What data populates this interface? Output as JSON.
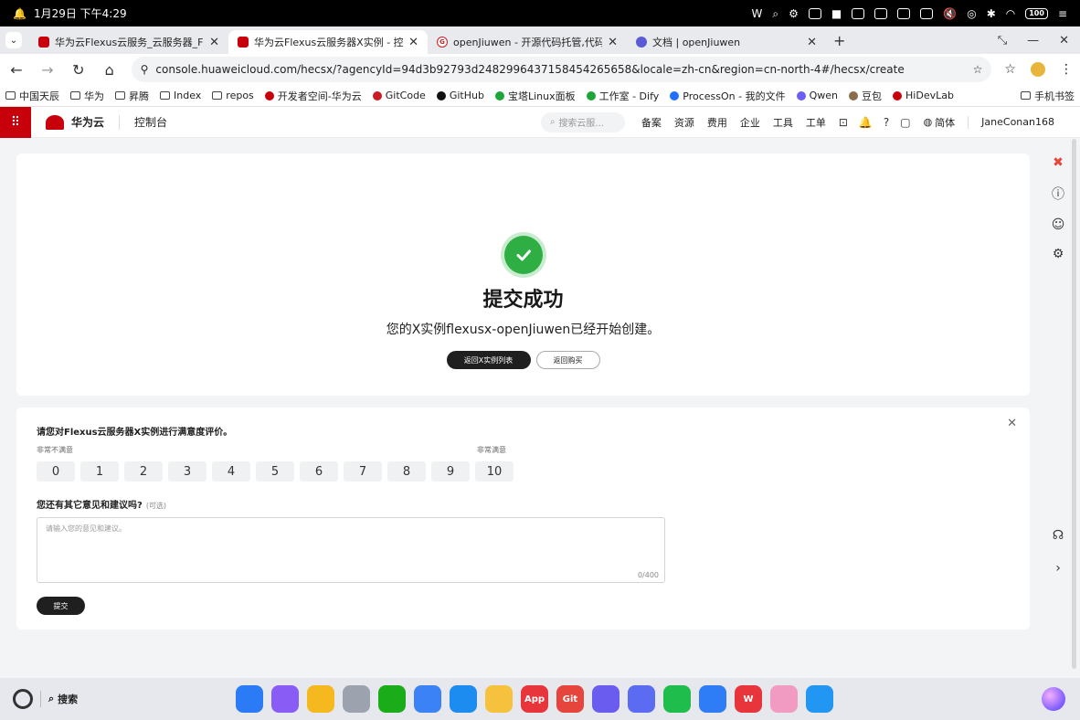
{
  "statusbar": {
    "datetime": "1月29日 下午4:29",
    "battery": "100"
  },
  "tabs": [
    {
      "label": "华为云Flexus云服务_云服务器_Flexu",
      "favicon": "huawei"
    },
    {
      "label": "华为云Flexus云服务器X实例 - 控制",
      "favicon": "huawei"
    },
    {
      "label": "openJiuwen - 开源代码托管,代码协",
      "favicon": "gitcode"
    },
    {
      "label": "文档 | openJiuwen",
      "favicon": "doc"
    }
  ],
  "address": {
    "url": "console.huaweicloud.com/hecsx/?agencyId=94d3b92793d2482996437158454265658&locale=zh-cn&region=cn-north-4#/hecsx/create"
  },
  "bookmarks": [
    "中国天辰",
    "华为",
    "昇腾",
    "Index",
    "repos",
    "开发者空间-华为云",
    "GitCode",
    "GitHub",
    "宝塔Linux面板",
    "工作室 - Dify",
    "ProcessOn - 我的文件",
    "Qwen",
    "豆包",
    "HiDevLab"
  ],
  "bookmarks_right": "手机书签",
  "console": {
    "brand": "华为云",
    "title": "控制台",
    "search_placeholder": "搜索云服...",
    "nav": [
      "备案",
      "资源",
      "费用",
      "企业",
      "工具",
      "工单"
    ],
    "language": "简体",
    "user": "JaneConan168"
  },
  "success": {
    "title": "提交成功",
    "description": "您的X实例flexusx-openJiuwen已经开始创建。",
    "btn_list": "返回X实例列表",
    "btn_buy": "返回购买"
  },
  "survey": {
    "question": "请您对Flexus云服务器X实例进行满意度评价。",
    "low_label": "非常不满意",
    "high_label": "非常满意",
    "scores": [
      "0",
      "1",
      "2",
      "3",
      "4",
      "5",
      "6",
      "7",
      "8",
      "9",
      "10"
    ],
    "q2": "您还有其它意见和建议吗?",
    "q2_optional": "(可选)",
    "placeholder": "请输入您的意见和建议。",
    "counter": "0/400",
    "submit": "提交"
  },
  "dock": {
    "search_label": "搜索",
    "apps": [
      {
        "name": "app-grid",
        "color": "#2a7bf5",
        "label": ""
      },
      {
        "name": "multitask",
        "color": "#8a5cf6",
        "label": ""
      },
      {
        "name": "notes",
        "color": "#f5b81f",
        "label": ""
      },
      {
        "name": "trash",
        "color": "#9ca3af",
        "label": ""
      },
      {
        "name": "wechat",
        "color": "#1aad19",
        "label": ""
      },
      {
        "name": "search",
        "color": "#3b82f6",
        "label": ""
      },
      {
        "name": "browser",
        "color": "#1d8cf0",
        "label": ""
      },
      {
        "name": "memo",
        "color": "#f6c23e",
        "label": ""
      },
      {
        "name": "app-gallery",
        "color": "#e8343b",
        "label": "App"
      },
      {
        "name": "git",
        "color": "#e5453a",
        "label": "Git"
      },
      {
        "name": "huawei-cloud",
        "color": "#6b5cf0",
        "label": ""
      },
      {
        "name": "devtools",
        "color": "#5b6cf2",
        "label": ""
      },
      {
        "name": "phone",
        "color": "#1fbd4b",
        "label": ""
      },
      {
        "name": "messages",
        "color": "#2f7df6",
        "label": ""
      },
      {
        "name": "wps",
        "color": "#e8343b",
        "label": "W"
      },
      {
        "name": "gallery",
        "color": "#f29bc2",
        "label": ""
      },
      {
        "name": "files",
        "color": "#2196f3",
        "label": ""
      }
    ]
  }
}
